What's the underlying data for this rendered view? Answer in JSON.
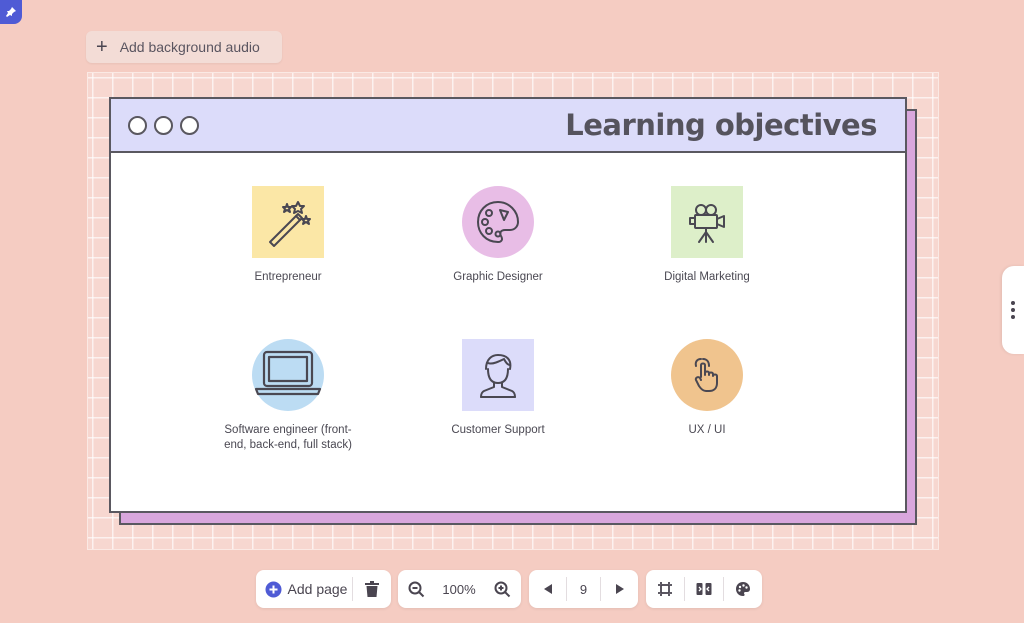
{
  "audio_button": {
    "label": "Add background audio",
    "icon": "plus-icon"
  },
  "slide": {
    "title": "Learning objectives",
    "items": [
      {
        "label": "Entrepreneur",
        "icon": "magic-wand-icon",
        "bg": "#fbe7a6"
      },
      {
        "label": "Graphic Designer",
        "icon": "palette-icon",
        "bg": "#e8bde6"
      },
      {
        "label": "Digital Marketing",
        "icon": "video-camera-icon",
        "bg": "#ddefc9"
      },
      {
        "label": "Software engineer (front-end, back-end, full stack)",
        "label_line1": "Software engineer (front-",
        "label_line2": "end, back-end, full stack)",
        "icon": "laptop-icon",
        "bg": "#bcdcf3"
      },
      {
        "label": "Customer Support",
        "icon": "person-icon",
        "bg": "#dcdcfa"
      },
      {
        "label": "UX / UI",
        "icon": "pointer-hand-icon",
        "bg": "#f0c48e"
      }
    ]
  },
  "toolbar": {
    "add_page": "Add page",
    "zoom": "100%",
    "page_number": "9"
  },
  "colors": {
    "background": "#f5ccc2",
    "accent": "#4f5bd5",
    "titlebar": "#dcdcfa",
    "card_shadow": "#d9a7dd"
  }
}
